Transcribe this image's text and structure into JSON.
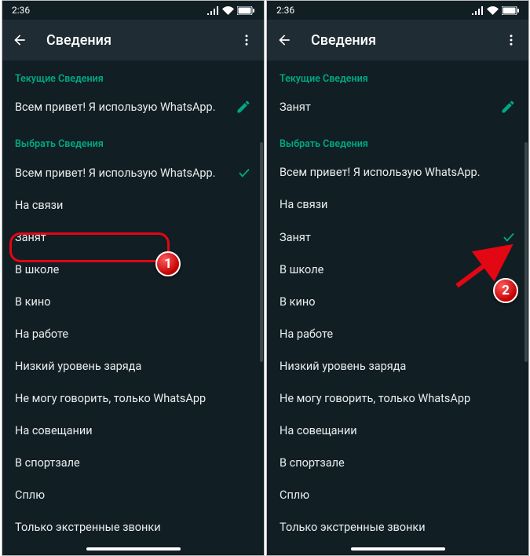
{
  "status": {
    "time": "2:36"
  },
  "appbar": {
    "title": "Сведения"
  },
  "left": {
    "section_current": "Текущие Сведения",
    "current_value": "Всем привет! Я использую WhatsApp.",
    "section_choose": "Выбрать Сведения",
    "selected_index": 0
  },
  "right": {
    "section_current": "Текущие Сведения",
    "current_value": "Занят",
    "section_choose": "Выбрать Сведения",
    "selected_index": 2
  },
  "options": [
    "Всем привет! Я использую WhatsApp.",
    "На связи",
    "Занят",
    "В школе",
    "В кино",
    "На работе",
    "Низкий уровень заряда",
    "Не могу говорить, только WhatsApp",
    "На совещании",
    "В спортзале",
    "Сплю",
    "Только экстренные звонки"
  ],
  "annotations": {
    "badge1": "1",
    "badge2": "2"
  }
}
